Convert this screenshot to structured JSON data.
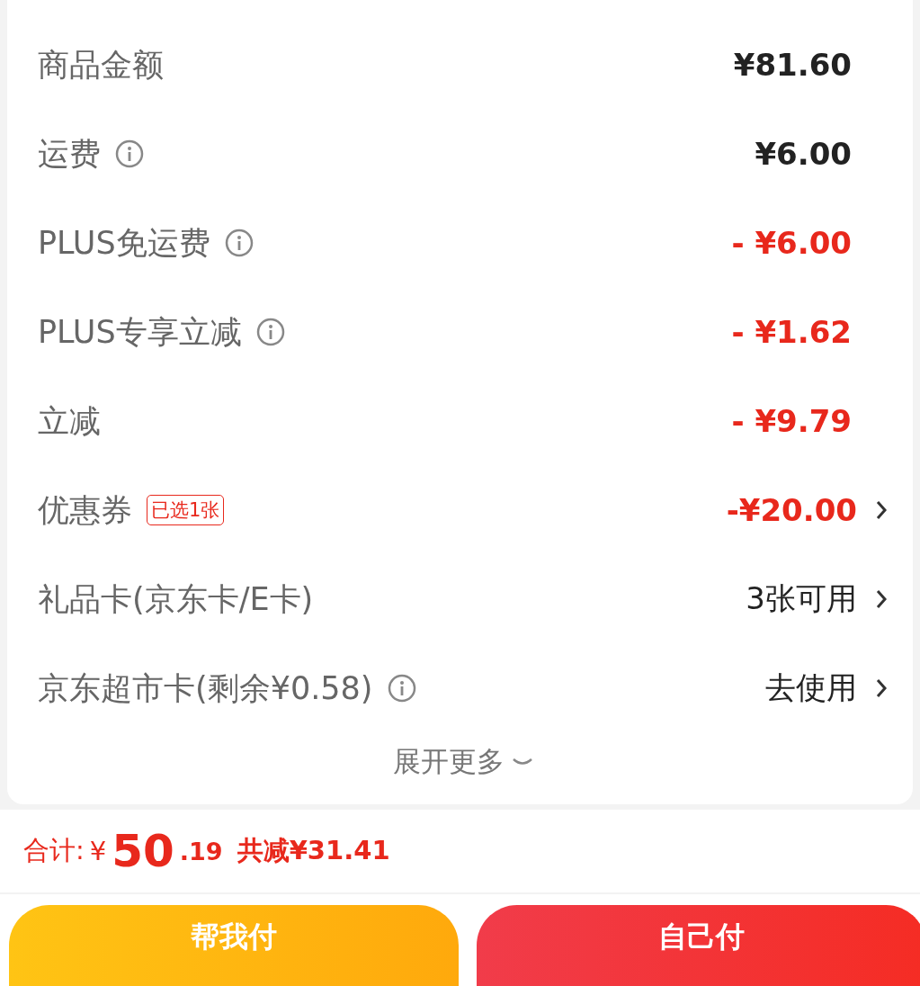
{
  "rows": [
    {
      "label": "商品金额",
      "info": false,
      "value": "¥81.60",
      "kind": "amount",
      "chevron": false
    },
    {
      "label": "运费",
      "info": true,
      "value": "¥6.00",
      "kind": "amount",
      "chevron": false
    },
    {
      "label": "PLUS免运费",
      "info": true,
      "value": "- ¥6.00",
      "kind": "discount",
      "chevron": false
    },
    {
      "label": "PLUS专享立减",
      "info": true,
      "value": "- ¥1.62",
      "kind": "discount",
      "chevron": false
    },
    {
      "label": "立减",
      "info": false,
      "value": "- ¥9.79",
      "kind": "discount",
      "chevron": false
    },
    {
      "label": "优惠券",
      "info": false,
      "badge": "已选1张",
      "value": "-¥20.00",
      "kind": "discount",
      "chevron": true
    },
    {
      "label": "礼品卡(京东卡/E卡)",
      "info": false,
      "value": "3张可用",
      "kind": "action",
      "chevron": true
    },
    {
      "label": "京东超市卡(剩余¥0.58)",
      "info": true,
      "value": "去使用",
      "kind": "action",
      "chevron": true
    }
  ],
  "expand": {
    "label": "展开更多"
  },
  "summary": {
    "label": "合计:",
    "currency": "¥",
    "integer": "50",
    "decimal": ".19",
    "saved": "共减¥31.41"
  },
  "buttons": [
    {
      "label": "帮我付",
      "kind": "help"
    },
    {
      "label": "自己付",
      "kind": "self"
    }
  ]
}
